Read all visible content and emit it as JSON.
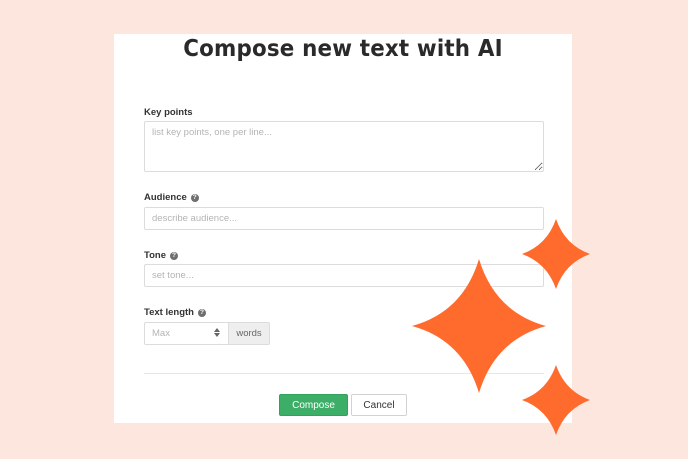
{
  "dialog": {
    "title": "Compose new text with AI",
    "key_points": {
      "label": "Key points",
      "placeholder": "list key points, one per line..."
    },
    "audience": {
      "label": "Audience",
      "help_icon": "question-circle-icon",
      "placeholder": "describe audience..."
    },
    "tone": {
      "label": "Tone",
      "help_icon": "question-circle-icon",
      "placeholder": "set tone..."
    },
    "text_length": {
      "label": "Text length",
      "help_icon": "question-circle-icon",
      "placeholder": "Max",
      "unit": "words"
    },
    "actions": {
      "compose_label": "Compose",
      "cancel_label": "Cancel"
    }
  },
  "colors": {
    "background": "#fce6de",
    "accent_sparkle": "#ff6b2c",
    "primary_button": "#3cae67"
  },
  "decorations": {
    "sparkle_icon": "four-point-star-icon"
  }
}
